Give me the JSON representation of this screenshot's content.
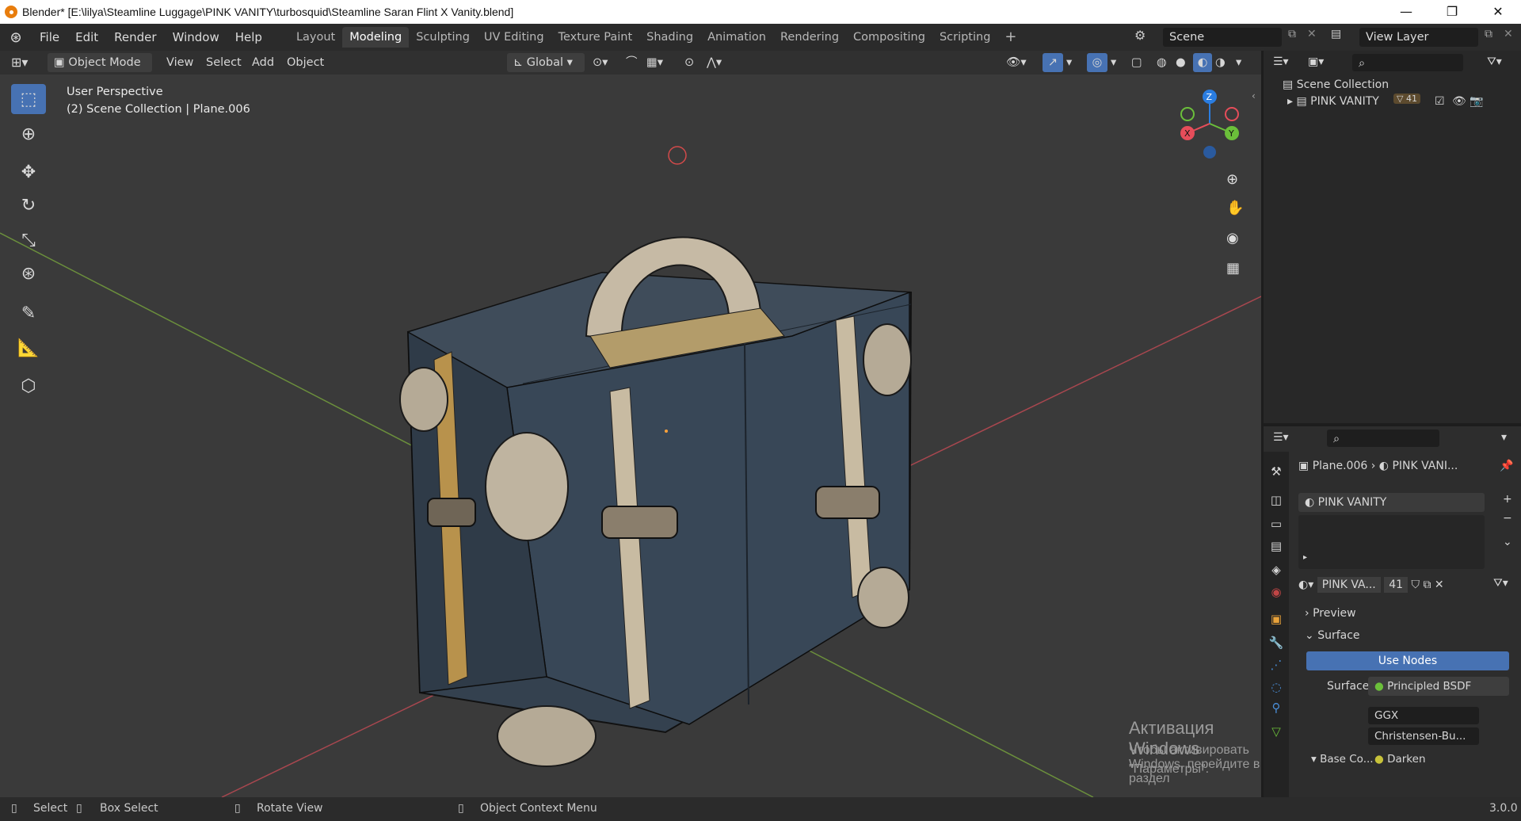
{
  "window": {
    "title": "Blender* [E:\\lilya\\Steamline Luggage\\PINK VANITY\\turbosquid\\Steamline Saran Flint X Vanity.blend]",
    "minimize": "—",
    "maximize": "❐",
    "close": "✕"
  },
  "menu": [
    "File",
    "Edit",
    "Render",
    "Window",
    "Help"
  ],
  "workspaces": [
    "Layout",
    "Modeling",
    "Sculpting",
    "UV Editing",
    "Texture Paint",
    "Shading",
    "Animation",
    "Rendering",
    "Compositing",
    "Scripting"
  ],
  "active_workspace": "Modeling",
  "add_workspace": "+",
  "scene_field": "Scene",
  "view_layer_field": "View Layer",
  "viewport_header": {
    "mode": "Object Mode",
    "view": "View",
    "select": "Select",
    "add": "Add",
    "object": "Object",
    "transform": "Global"
  },
  "viewport": {
    "perspective_label": "User Perspective",
    "collection_label": "(2) Scene Collection | Plane.006",
    "gizmo": {
      "z": "Z",
      "y": "Y",
      "x": "X"
    }
  },
  "outliner": {
    "root": "Scene Collection",
    "item": "PINK VANITY",
    "item_badge": "41"
  },
  "properties": {
    "breadcrumb_object": "Plane.006",
    "breadcrumb_material": "PINK VANI...",
    "material_slot": "PINK VANITY",
    "material_name": "PINK VA...",
    "material_users": "41",
    "preview_panel": "Preview",
    "surface_panel": "Surface",
    "use_nodes": "Use Nodes",
    "surface_label": "Surface",
    "surface_value": "Principled BSDF",
    "distribution": "GGX",
    "subsurface": "Christensen-Bu...",
    "base_color_label": "Base Co...",
    "base_color_value": "Darken"
  },
  "watermark": {
    "line1": "Активация Windows",
    "line2": "Чтобы активировать Windows, перейдите в раздел",
    "line3": "\"Параметры\"."
  },
  "statusbar": {
    "select": "Select",
    "box_select": "Box Select",
    "rotate_view": "Rotate View",
    "context_menu": "Object Context Menu",
    "version": "3.0.0"
  },
  "colors": {
    "accent": "#4772b3",
    "x_axis": "#e64d5a",
    "y_axis": "#6bbf3a",
    "z_axis": "#2a7de1"
  }
}
